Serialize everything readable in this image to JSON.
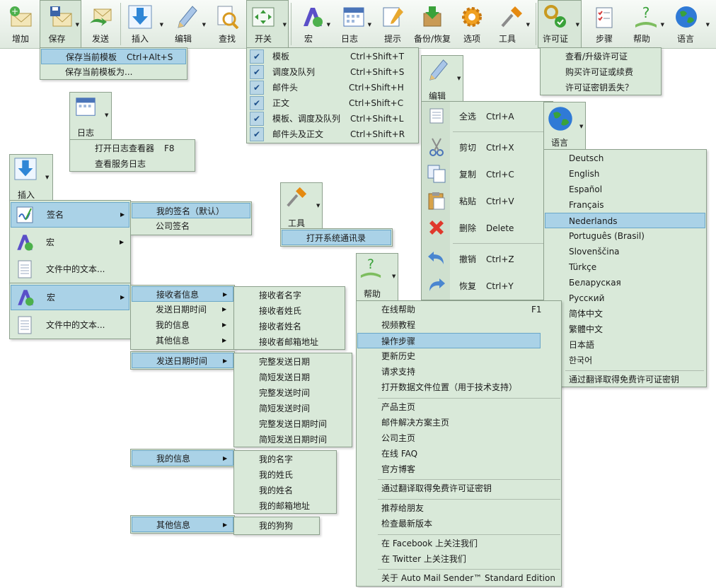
{
  "toolbar": {
    "items": [
      {
        "label": "增加"
      },
      {
        "label": "保存"
      },
      {
        "label": "发送"
      },
      {
        "label": "插入"
      },
      {
        "label": "编辑"
      },
      {
        "label": "查找"
      },
      {
        "label": "开关"
      },
      {
        "label": "宏"
      },
      {
        "label": "日志"
      },
      {
        "label": "提示"
      },
      {
        "label": "备份/恢复"
      },
      {
        "label": "选项"
      },
      {
        "label": "工具"
      },
      {
        "label": "许可证"
      },
      {
        "label": "步骤"
      },
      {
        "label": "帮助"
      },
      {
        "label": "语言"
      }
    ]
  },
  "save_menu": {
    "items": [
      {
        "label": "保存当前模板",
        "shortcut": "Ctrl+Alt+S"
      },
      {
        "label": "保存当前模板为...",
        "shortcut": ""
      }
    ]
  },
  "switch_menu": {
    "items": [
      {
        "label": "模板",
        "shortcut": "Ctrl+Shift+T"
      },
      {
        "label": "调度及队列",
        "shortcut": "Ctrl+Shift+S"
      },
      {
        "label": "邮件头",
        "shortcut": "Ctrl+Shift+H"
      },
      {
        "label": "正文",
        "shortcut": "Ctrl+Shift+C"
      },
      {
        "label": "模板、调度及队列",
        "shortcut": "Ctrl+Shift+L"
      },
      {
        "label": "邮件头及正文",
        "shortcut": "Ctrl+Shift+R"
      }
    ]
  },
  "license_menu": {
    "items": [
      {
        "label": "查看/升级许可证"
      },
      {
        "label": "购买许可证或续费"
      },
      {
        "label": "许可证密钥丢失？"
      }
    ]
  },
  "log_button": {
    "label": "日志"
  },
  "log_menu": {
    "items": [
      {
        "label": "打开日志查看器",
        "shortcut": "F8"
      },
      {
        "label": "查看服务日志",
        "shortcut": ""
      }
    ]
  },
  "edit_button": {
    "label": "编辑"
  },
  "edit_menu": {
    "items": [
      {
        "label": "全选",
        "shortcut": "Ctrl+A",
        "icon": "select-all-icon"
      },
      {
        "label": "剪切",
        "shortcut": "Ctrl+X",
        "icon": "scissors-icon"
      },
      {
        "label": "复制",
        "shortcut": "Ctrl+C",
        "icon": "copy-icon"
      },
      {
        "label": "粘贴",
        "shortcut": "Ctrl+V",
        "icon": "paste-icon"
      },
      {
        "label": "删除",
        "shortcut": "Delete",
        "icon": "delete-icon"
      },
      {
        "label": "撤销",
        "shortcut": "Ctrl+Z",
        "icon": "undo-icon"
      },
      {
        "label": "恢复",
        "shortcut": "Ctrl+Y",
        "icon": "redo-icon"
      }
    ]
  },
  "language_button": {
    "label": "语言"
  },
  "language_menu": {
    "items": [
      {
        "label": "Deutsch"
      },
      {
        "label": "English"
      },
      {
        "label": "Español"
      },
      {
        "label": "Français"
      },
      {
        "label": "Nederlands"
      },
      {
        "label": "Português (Brasil)"
      },
      {
        "label": "Slovenščina"
      },
      {
        "label": "Türkçe"
      },
      {
        "label": "Беларуская"
      },
      {
        "label": "Русский"
      },
      {
        "label": "简体中文"
      },
      {
        "label": "繁體中文"
      },
      {
        "label": "日本語"
      },
      {
        "label": "한국어"
      }
    ],
    "free_key": "通过翻译取得免费许可证密钥"
  },
  "insert_button": {
    "label": "插入"
  },
  "insert_menu": {
    "items": [
      {
        "label": "签名"
      },
      {
        "label": "宏"
      },
      {
        "label": "文件中的文本..."
      }
    ]
  },
  "signature_submenu": {
    "items": [
      {
        "label": "我的签名（默认）"
      },
      {
        "label": "公司签名"
      }
    ]
  },
  "tools_button": {
    "label": "工具"
  },
  "tools_menu": {
    "items": [
      {
        "label": "打开系统通讯录"
      }
    ]
  },
  "insert_menu2": {
    "items": [
      {
        "label": "宏"
      },
      {
        "label": "文件中的文本..."
      }
    ]
  },
  "macro_submenu": {
    "items": [
      {
        "label": "接收者信息"
      },
      {
        "label": "发送日期时间"
      },
      {
        "label": "我的信息"
      },
      {
        "label": "其他信息"
      }
    ]
  },
  "recipient_submenu": {
    "items": [
      {
        "label": "接收者名字"
      },
      {
        "label": "接收者姓氏"
      },
      {
        "label": "接收者姓名"
      },
      {
        "label": "接收者邮箱地址"
      }
    ]
  },
  "send_date_header": {
    "label": "发送日期时间"
  },
  "send_date_submenu": {
    "items": [
      {
        "label": "完整发送日期"
      },
      {
        "label": "简短发送日期"
      },
      {
        "label": "完整发送时间"
      },
      {
        "label": "简短发送时间"
      },
      {
        "label": "完整发送日期时间"
      },
      {
        "label": "简短发送日期时间"
      }
    ]
  },
  "my_info_header": {
    "label": "我的信息"
  },
  "my_info_submenu": {
    "items": [
      {
        "label": "我的名字"
      },
      {
        "label": "我的姓氏"
      },
      {
        "label": "我的姓名"
      },
      {
        "label": "我的邮箱地址"
      }
    ]
  },
  "other_info_header": {
    "label": "其他信息"
  },
  "other_info_submenu": {
    "items": [
      {
        "label": "我的狗狗"
      }
    ]
  },
  "help_button": {
    "label": "帮助"
  },
  "help_menu": {
    "items": [
      {
        "label": "在线帮助",
        "shortcut": "F1"
      },
      {
        "label": "视频教程"
      },
      {
        "label": "操作步骤"
      },
      {
        "label": "更新历史"
      },
      {
        "label": "请求支持"
      },
      {
        "label": "打开数据文件位置（用于技术支持）"
      },
      {
        "label": "产品主页"
      },
      {
        "label": "邮件解决方案主页"
      },
      {
        "label": "公司主页"
      },
      {
        "label": "在线 FAQ"
      },
      {
        "label": "官方博客"
      },
      {
        "label": "通过翻译取得免费许可证密钥"
      },
      {
        "label": "推荐给朋友"
      },
      {
        "label": "检查最新版本"
      },
      {
        "label": "在 Facebook 上关注我们"
      },
      {
        "label": "在 Twitter 上关注我们"
      },
      {
        "label": "关于 Auto Mail Sender™ Standard Edition"
      }
    ]
  },
  "colors": {
    "menu_bg": "#d9e9d9",
    "highlight": "#aad2e7",
    "border": "#8da08d"
  }
}
